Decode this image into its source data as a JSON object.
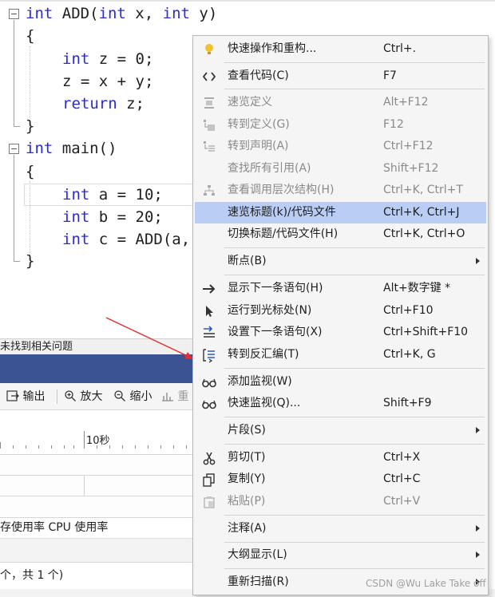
{
  "code": {
    "line1": [
      "int",
      " ADD(",
      "int",
      " x, ",
      "int",
      " y)"
    ],
    "line2": "{",
    "line3": [
      "int",
      " z = 0;"
    ],
    "line4": "z = x + y;",
    "line5": [
      "return",
      " z;"
    ],
    "line6": "}",
    "line7": [
      "int",
      " main()"
    ],
    "line8": "{",
    "line9": [
      "int",
      " a = 10;"
    ],
    "line10": [
      "int",
      " b = 20;"
    ],
    "line11": [
      "int",
      " c = ADD(a,"
    ],
    "line12": "}"
  },
  "colors": {
    "keyword": "#2b2bd6",
    "menu_highlight": "#b9cdf5",
    "panel_header": "#3b5392",
    "arrow": "#e03030"
  },
  "panel": {
    "status_text": "未找到相关问题",
    "toolbar": {
      "output": "输出",
      "zoom_in": "放大",
      "zoom_out": "缩小",
      "reset": "重"
    },
    "ruler_label": "10秒",
    "tabs_text": "存使用率   CPU 使用率",
    "count_text": "个，共 1 个)"
  },
  "menu": {
    "items": [
      {
        "label": "快速操作和重构...",
        "shortcut": "Ctrl+.",
        "icon": "lightbulb-icon",
        "disabled": false
      },
      {
        "label": "查看代码(C)",
        "shortcut": "F7",
        "icon": "code-brackets-icon",
        "disabled": false
      },
      {
        "label": "速览定义",
        "shortcut": "Alt+F12",
        "icon": "peek-definition-icon",
        "disabled": true
      },
      {
        "label": "转到定义(G)",
        "shortcut": "F12",
        "icon": "goto-definition-icon",
        "disabled": true
      },
      {
        "label": "转到声明(A)",
        "shortcut": "Ctrl+F12",
        "icon": "goto-declaration-icon",
        "disabled": true
      },
      {
        "label": "查找所有引用(A)",
        "shortcut": "Shift+F12",
        "icon": "",
        "disabled": true
      },
      {
        "label": "查看调用层次结构(H)",
        "shortcut": "Ctrl+K, Ctrl+T",
        "icon": "call-hierarchy-icon",
        "disabled": true
      },
      {
        "label": "速览标题(k)/代码文件",
        "shortcut": "Ctrl+K, Ctrl+J",
        "icon": "",
        "disabled": false,
        "highlighted": true
      },
      {
        "label": "切换标题/代码文件(H)",
        "shortcut": "Ctrl+K, Ctrl+O",
        "icon": "",
        "disabled": false
      },
      {
        "label": "断点(B)",
        "shortcut": "",
        "icon": "",
        "disabled": false,
        "submenu": true
      },
      {
        "label": "显示下一条语句(H)",
        "shortcut": "Alt+数字键 *",
        "icon": "right-arrow-icon",
        "disabled": false
      },
      {
        "label": "运行到光标处(N)",
        "shortcut": "Ctrl+F10",
        "icon": "cursor-icon",
        "disabled": false
      },
      {
        "label": "设置下一条语句(X)",
        "shortcut": "Ctrl+Shift+F10",
        "icon": "set-next-statement-icon",
        "disabled": false
      },
      {
        "label": "转到反汇编(T)",
        "shortcut": "Ctrl+K, G",
        "icon": "disassembly-icon",
        "disabled": false
      },
      {
        "label": "添加监视(W)",
        "shortcut": "",
        "icon": "glasses-icon",
        "disabled": false
      },
      {
        "label": "快速监视(Q)...",
        "shortcut": "Shift+F9",
        "icon": "glasses-icon",
        "disabled": false
      },
      {
        "label": "片段(S)",
        "shortcut": "",
        "icon": "",
        "disabled": false,
        "submenu": true
      },
      {
        "label": "剪切(T)",
        "shortcut": "Ctrl+X",
        "icon": "scissors-icon",
        "disabled": false
      },
      {
        "label": "复制(Y)",
        "shortcut": "Ctrl+C",
        "icon": "copy-icon",
        "disabled": false
      },
      {
        "label": "粘贴(P)",
        "shortcut": "Ctrl+V",
        "icon": "paste-icon",
        "disabled": true
      },
      {
        "label": "注释(A)",
        "shortcut": "",
        "icon": "",
        "disabled": false,
        "submenu": true
      },
      {
        "label": "大纲显示(L)",
        "shortcut": "",
        "icon": "",
        "disabled": false,
        "submenu": true
      },
      {
        "label": "重新扫描(R)",
        "shortcut": "",
        "icon": "",
        "disabled": false,
        "submenu": true
      }
    ]
  },
  "watermark": "CSDN @Wu Lake Take off"
}
